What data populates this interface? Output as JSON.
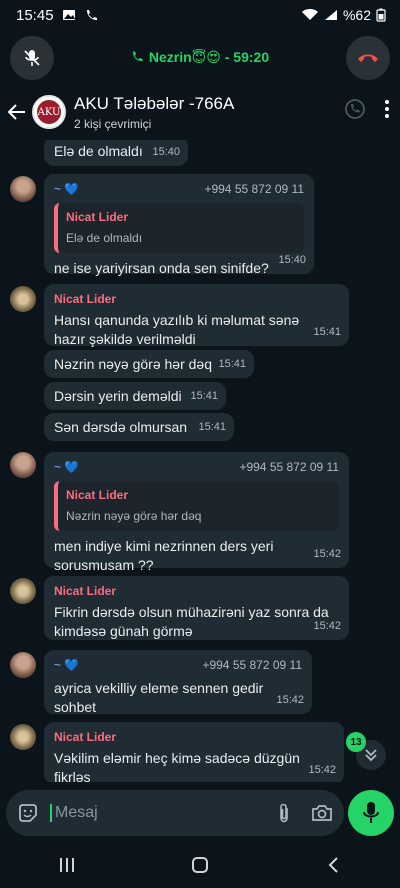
{
  "status": {
    "time": "15:45",
    "battery": "%62"
  },
  "call": {
    "label": "Nezrin😇😍 - 59:20"
  },
  "header": {
    "title": "AKU Tələbələr -766A",
    "subtitle": "2 kişi çevrimiçi",
    "avatar_text": "AKU"
  },
  "messages": [
    {
      "text": "Elə de olmaldı",
      "time": "15:40"
    },
    {
      "sender_name": "~ 💙",
      "sender_phone": "+994 55 872 09 11",
      "quote_name": "Nicat Lider",
      "quote_text": "Elə de olmaldı",
      "text": "ne ise yariyirsan onda sen sinifde?",
      "time": "15:40"
    },
    {
      "sender": "Nicat Lider",
      "text": "Hansı qanunda yazılıb ki məlumat sənə hazır şəkildə verilməldi",
      "time": "15:41"
    },
    {
      "text": "Nəzrin nəyə görə hər dəq",
      "time": "15:41"
    },
    {
      "text": "Dərsin yerin deməldi",
      "time": "15:41"
    },
    {
      "text": "Sən dərsdə olmursan",
      "time": "15:41"
    },
    {
      "sender_name": "~ 💙",
      "sender_phone": "+994 55 872 09 11",
      "quote_name": "Nicat Lider",
      "quote_text": "Nəzrin nəyə görə hər dəq",
      "text": "men indiye kimi nezrinnen ders yeri sorusmusam ??",
      "time": "15:42"
    },
    {
      "sender": "Nicat Lider",
      "text": "Fikrin dərsdə olsun mühazirəni yaz sonra da kimdəsə günah görmə",
      "time": "15:42"
    },
    {
      "sender_name": "~ 💙",
      "sender_phone": "+994 55 872 09 11",
      "text": "ayrica vekilliy eleme sennen gedir sohbet",
      "time": "15:42"
    },
    {
      "sender": "Nicat Lider",
      "text": "Vəkilim eləmir heç kimə sadəcə düzgün fikrləş",
      "time": "15:42"
    }
  ],
  "unread_count": "13",
  "composer": {
    "placeholder": "Mesaj"
  },
  "colors": {
    "accent": "#25d366",
    "sender_red": "#ff6b7e",
    "bubble": "#202c33",
    "background": "#0b141a"
  }
}
